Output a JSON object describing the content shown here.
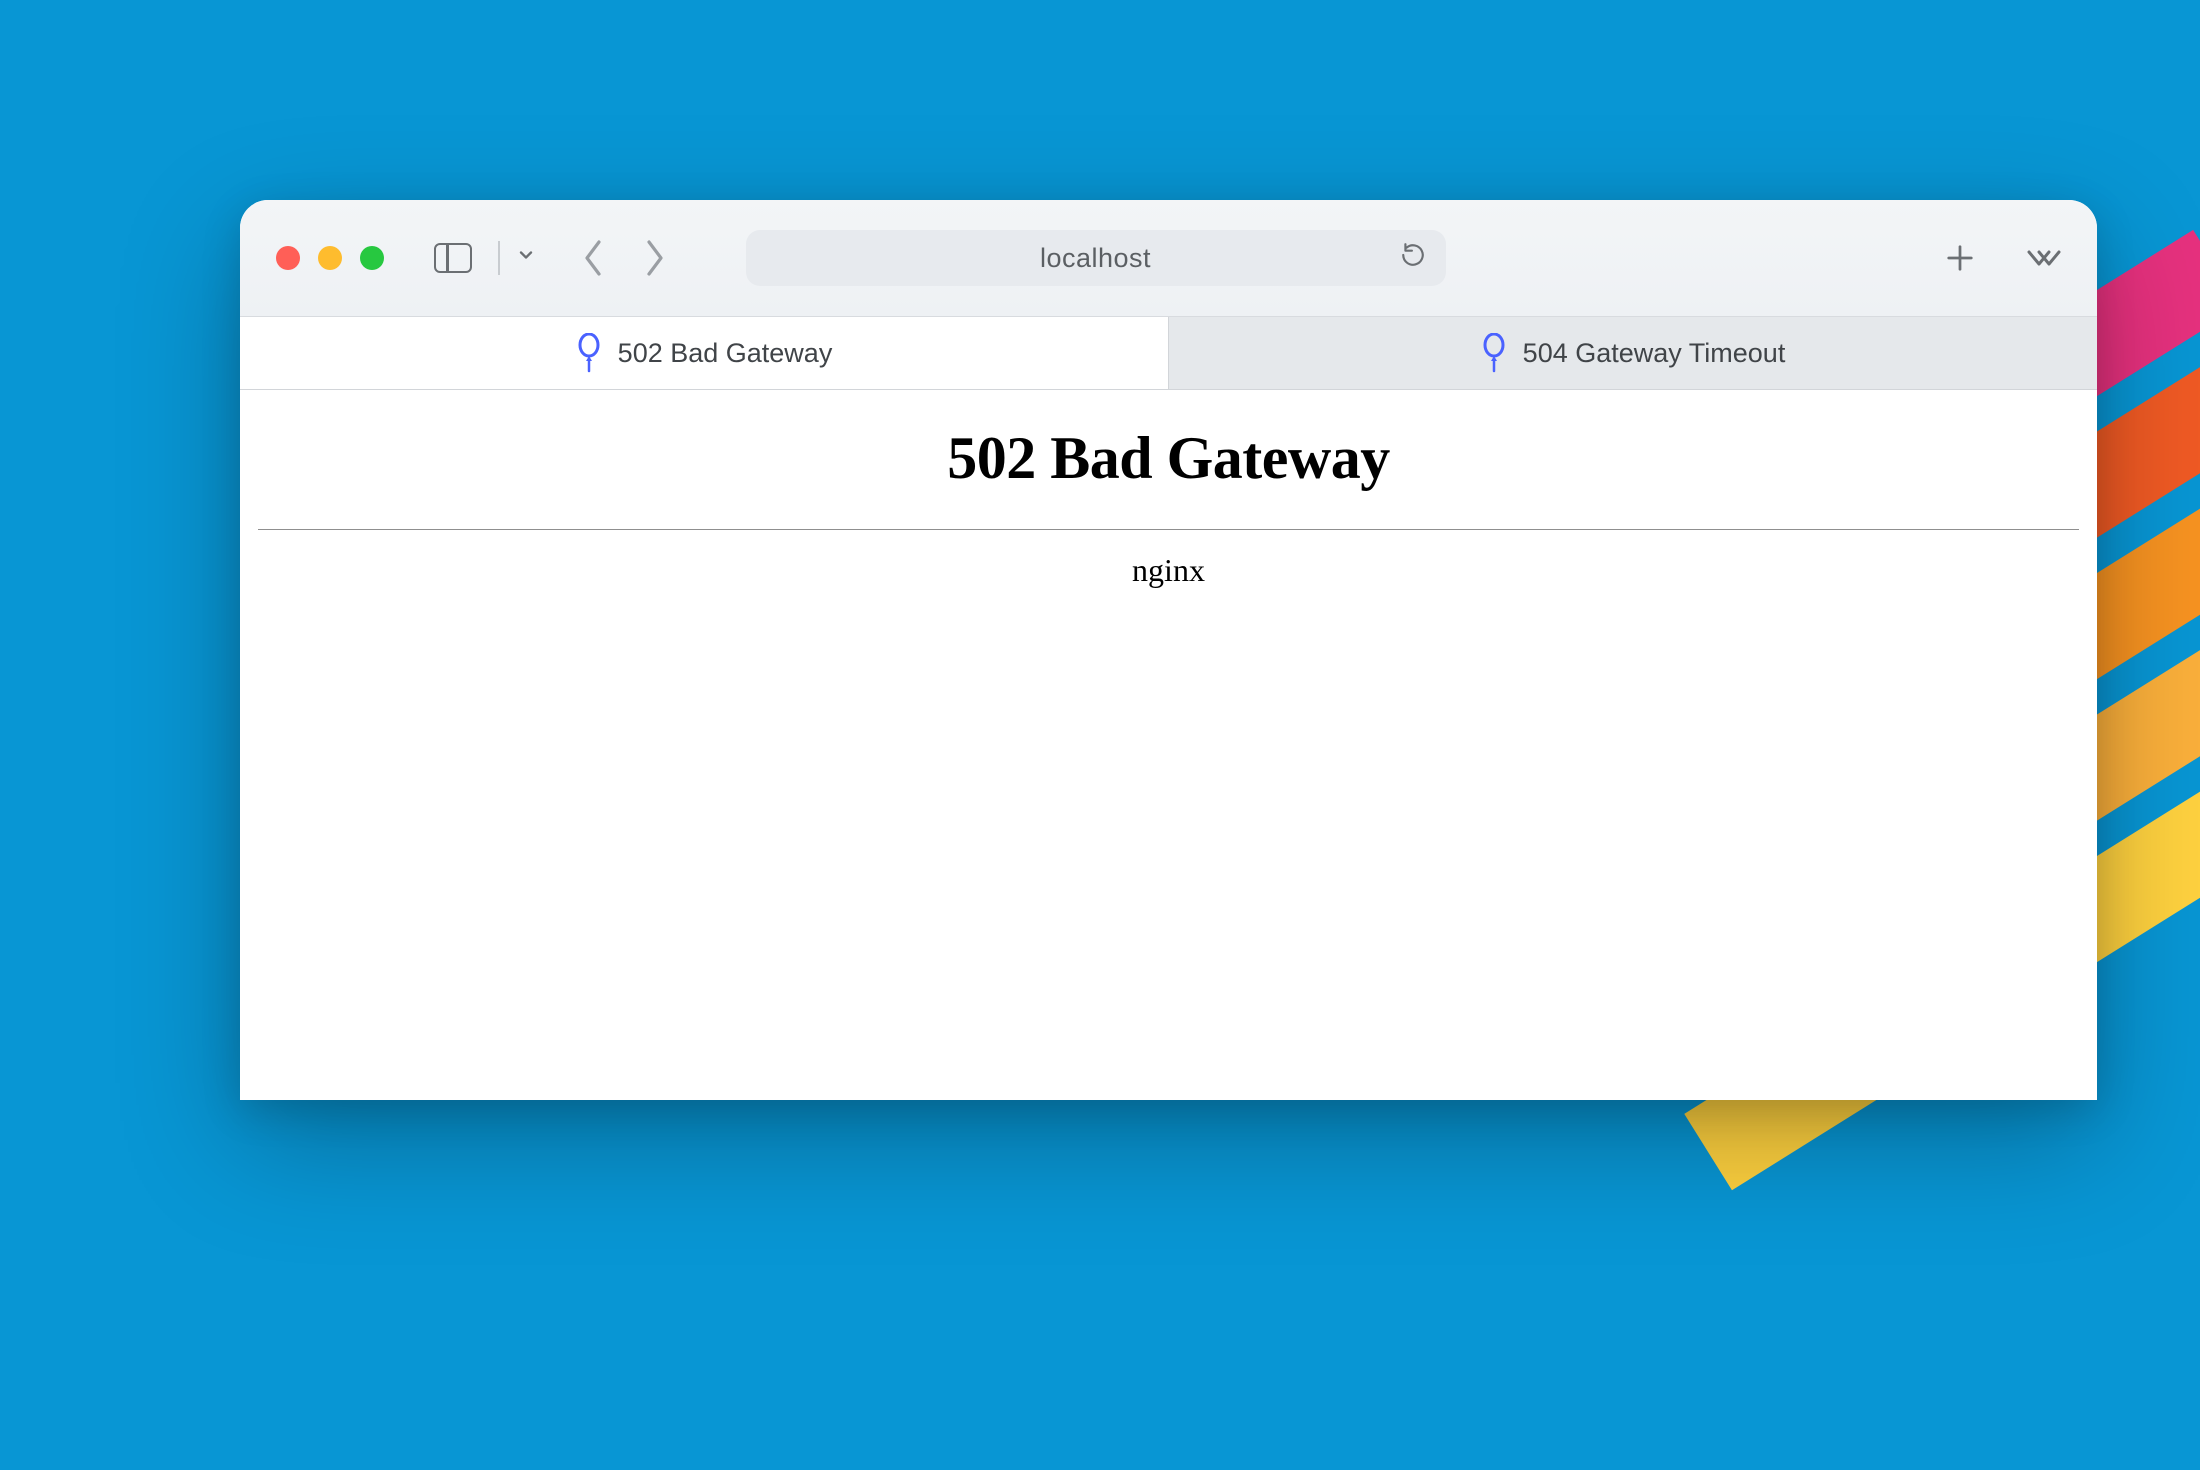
{
  "toolbar": {
    "address": "localhost"
  },
  "tabs": [
    {
      "label": "502 Bad Gateway",
      "active": true
    },
    {
      "label": "504 Gateway Timeout",
      "active": false
    }
  ],
  "page": {
    "heading": "502 Bad Gateway",
    "server": "nginx"
  },
  "colors": {
    "background": "#0896d4",
    "stripe_pink": "#e6317e",
    "stripe_orange": "#f05a24",
    "stripe_amber": "#f79321",
    "stripe_gold": "#fbb03b",
    "traffic_close": "#ff5f57",
    "traffic_min": "#febc2e",
    "traffic_max": "#27c840"
  }
}
